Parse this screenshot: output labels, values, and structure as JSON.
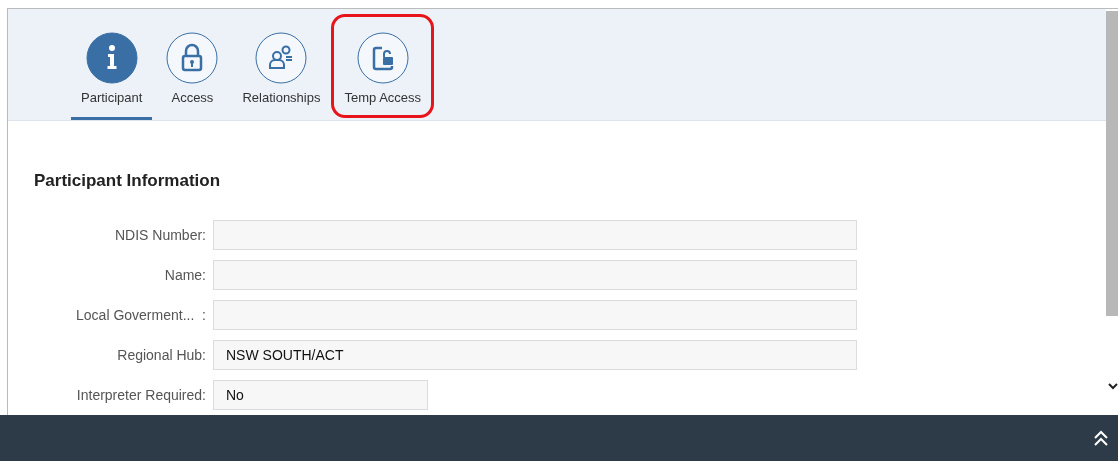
{
  "tabs": [
    {
      "label": "Participant",
      "kind": "info",
      "selected": true,
      "highlighted": false
    },
    {
      "label": "Access",
      "kind": "lock",
      "selected": false,
      "highlighted": false
    },
    {
      "label": "Relationships",
      "kind": "people",
      "selected": false,
      "highlighted": false
    },
    {
      "label": "Temp Access",
      "kind": "doc-lock",
      "selected": false,
      "highlighted": true
    }
  ],
  "section": {
    "title": "Participant Information"
  },
  "fields": [
    {
      "label": "NDIS Number:",
      "kind": "wide"
    },
    {
      "label": "Name:",
      "kind": "wide"
    },
    {
      "label": "Local Goverment...  :",
      "kind": "wide"
    },
    {
      "label": "Regional Hub:",
      "kind": "wide",
      "value": "NSW SOUTH/ACT"
    },
    {
      "label": "Interpreter Required:",
      "kind": "short",
      "value": "No"
    }
  ]
}
